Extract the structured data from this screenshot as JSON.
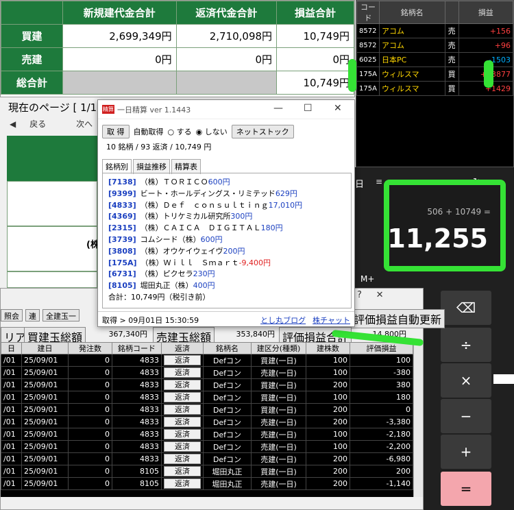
{
  "summary": {
    "headers": [
      "新規建代金合計",
      "返済代金合計",
      "損益合計"
    ],
    "rows": [
      {
        "label": "買建",
        "new": "2,699,349円",
        "repay": "2,710,098円",
        "pl": "10,749円"
      },
      {
        "label": "売建",
        "new": "0円",
        "repay": "0円",
        "pl": "0円"
      },
      {
        "label": "総合計",
        "new": "",
        "repay": "",
        "pl": "10,749円"
      }
    ]
  },
  "page_nav": {
    "current": "現在のページ [ 1/1",
    "back": "戻る",
    "next": "次へ",
    "indicator": "0"
  },
  "behind": {
    "paren_text": "(株",
    "calc_label": "日"
  },
  "stock_panel": {
    "headers": [
      "コード",
      "銘柄名",
      "",
      "損益"
    ],
    "rows": [
      {
        "code": "8572",
        "name": "アコム",
        "side": "売",
        "pl": "+156",
        "sign": "pos"
      },
      {
        "code": "8572",
        "name": "アコム",
        "side": "売",
        "pl": "+96",
        "sign": "pos"
      },
      {
        "code": "6025",
        "name": "日本PC",
        "side": "売",
        "pl": "-1503",
        "sign": "neg"
      },
      {
        "code": "175A",
        "name": "ウィルスマ",
        "side": "買",
        "pl": "+13877",
        "sign": "pos"
      },
      {
        "code": "175A",
        "name": "ウィルスマ",
        "side": "買",
        "pl": "+1429",
        "sign": "pos"
      }
    ]
  },
  "popup": {
    "title": "一日精算 ver 1.1443",
    "icon_text": "精算",
    "fetch_btn": "取 得",
    "auto_label": "自動取得",
    "opt_on": "する",
    "opt_off": "しない",
    "netstock_btn": "ネットストック",
    "summary_line": "10 銘柄 / 93 返済 / 10,749 円",
    "tabs": [
      "銘柄別",
      "損益推移",
      "精算表"
    ],
    "stocks": [
      {
        "code": "[7138]",
        "name": "（株）ＴＯＲＩＣＯ",
        "value": "600円",
        "neg": false
      },
      {
        "code": "[9399]",
        "name": "ビート・ホールディングス・リミテッド",
        "value": "629円",
        "neg": false
      },
      {
        "code": "[4833]",
        "name": "（株）Ｄｅｆ　ｃｏｎｓｕｌｔｉｎｇ",
        "value": "17,010円",
        "neg": false
      },
      {
        "code": "[4369]",
        "name": "（株）トリケミカル研究所",
        "value": "300円",
        "neg": false
      },
      {
        "code": "[2315]",
        "name": "（株）ＣＡＩＣＡ　ＤＩＧＩＴＡＬ",
        "value": "180円",
        "neg": false
      },
      {
        "code": "[3739]",
        "name": "コムシード（株）",
        "value": "600円",
        "neg": false
      },
      {
        "code": "[3808]",
        "name": "（株）オウケイウェイヴ",
        "value": "200円",
        "neg": false
      },
      {
        "code": "[175A]",
        "name": "（株）Ｗｉｌｌ　Ｓｍａｒｔ",
        "value": "-9,400円",
        "neg": true
      },
      {
        "code": "[6731]",
        "name": "（株）ピクセラ",
        "value": "230円",
        "neg": false
      },
      {
        "code": "[8105]",
        "name": "堀田丸正（株）",
        "value": "400円",
        "neg": false
      }
    ],
    "total": "合計：10,749円（税引き前）",
    "status": "取得 > 09月01日 15:30:59",
    "link1": "とし丸ブログ",
    "link2": "株チャット"
  },
  "calculator": {
    "expression": "506 + 10749 =",
    "result": "11,255",
    "m_plus": "M+"
  },
  "bottom": {
    "tab1": "照会",
    "tab2": "連",
    "tab3": "全建玉一",
    "auto_update": "評価損益自動更新",
    "question": "?",
    "clear_btn": "リア",
    "buy_total_btn": "買建玉総額",
    "buy_total": "367,340円",
    "sell_total_btn": "売建玉総額",
    "sell_total": "353,840円",
    "pl_total_btn": "評価損益合計",
    "pl_total": "-14,800円",
    "columns": [
      "日",
      "建日",
      "発注数",
      "銘柄コード",
      "返済",
      "銘柄名",
      "建区分(種類)",
      "建株数",
      "評価損益"
    ],
    "repay_label": "返済",
    "rows": [
      {
        "d": "/01",
        "date": "25/09/01",
        "ord": "0",
        "code": "4833",
        "name": "Defコン",
        "kind": "買建(一日)",
        "qty": "100",
        "pl": "100"
      },
      {
        "d": "/01",
        "date": "25/09/01",
        "ord": "0",
        "code": "4833",
        "name": "Defコン",
        "kind": "売建(一日)",
        "qty": "100",
        "pl": "-380"
      },
      {
        "d": "/01",
        "date": "25/09/01",
        "ord": "0",
        "code": "4833",
        "name": "Defコン",
        "kind": "買建(一日)",
        "qty": "200",
        "pl": "380"
      },
      {
        "d": "/01",
        "date": "25/09/01",
        "ord": "0",
        "code": "4833",
        "name": "Defコン",
        "kind": "買建(一日)",
        "qty": "100",
        "pl": "180"
      },
      {
        "d": "/01",
        "date": "25/09/01",
        "ord": "0",
        "code": "4833",
        "name": "Defコン",
        "kind": "買建(一日)",
        "qty": "200",
        "pl": "0"
      },
      {
        "d": "/01",
        "date": "25/09/01",
        "ord": "0",
        "code": "4833",
        "name": "Defコン",
        "kind": "売建(一日)",
        "qty": "200",
        "pl": "-3,380"
      },
      {
        "d": "/01",
        "date": "25/09/01",
        "ord": "0",
        "code": "4833",
        "name": "Defコン",
        "kind": "売建(一日)",
        "qty": "100",
        "pl": "-2,180"
      },
      {
        "d": "/01",
        "date": "25/09/01",
        "ord": "0",
        "code": "4833",
        "name": "Defコン",
        "kind": "売建(一日)",
        "qty": "100",
        "pl": "-2,200"
      },
      {
        "d": "/01",
        "date": "25/09/01",
        "ord": "0",
        "code": "4833",
        "name": "Defコン",
        "kind": "売建(一日)",
        "qty": "200",
        "pl": "-6,980"
      },
      {
        "d": "/01",
        "date": "25/09/01",
        "ord": "0",
        "code": "8105",
        "name": "堀田丸正",
        "kind": "買建(一日)",
        "qty": "200",
        "pl": "200"
      },
      {
        "d": "/01",
        "date": "25/09/01",
        "ord": "0",
        "code": "8105",
        "name": "堀田丸正",
        "kind": "売建(一日)",
        "qty": "200",
        "pl": "-1,140"
      }
    ]
  },
  "colors": {
    "green_header": "#1e7a3c",
    "marker": "#35e235",
    "link": "#1a3fc0",
    "negative": "#e02020"
  }
}
